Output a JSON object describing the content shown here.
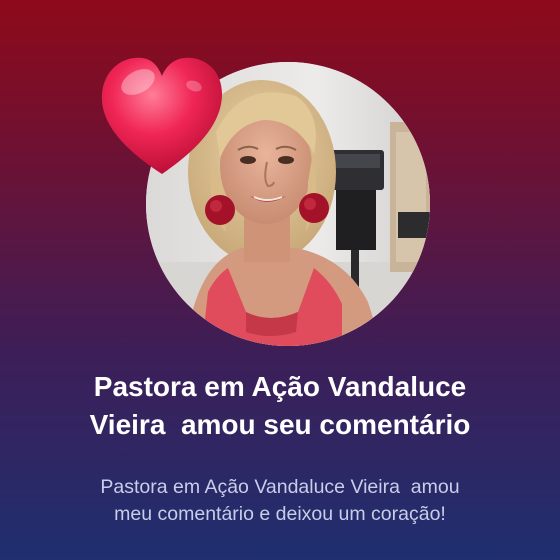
{
  "notification": {
    "title_line1": "Pastora em Ação Vandaluce",
    "title_line2": "Vieira  amou seu comentário",
    "subtitle_line1": "Pastora em Ação Vandaluce Vieira  amou",
    "subtitle_line2": "meu comentário e deixou um coração!"
  },
  "icons": {
    "heart": "heart-icon"
  },
  "colors": {
    "background_top": "#8e0a1a",
    "background_bottom": "#1f2f70",
    "title_text": "#ffffff",
    "subtitle_text": "#c8cde8",
    "heart": "#e8154a"
  }
}
